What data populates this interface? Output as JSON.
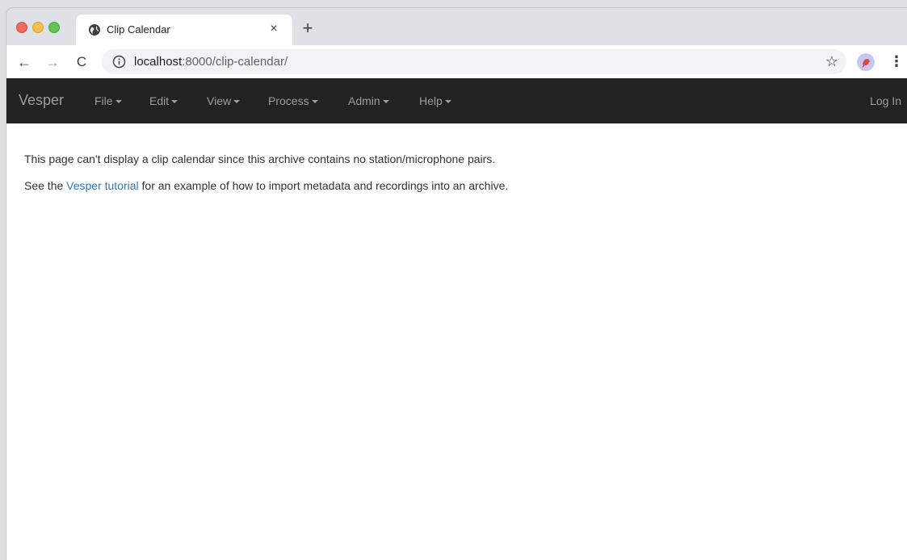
{
  "browser": {
    "tab_title": "Clip Calendar",
    "tab_close": "×",
    "new_tab": "+",
    "url_host": "localhost",
    "url_path": ":8000/clip-calendar/",
    "nav": {
      "back": "←",
      "forward": "→",
      "reload": "C"
    },
    "star": "☆",
    "menu": "⋮"
  },
  "navbar": {
    "brand": "Vesper",
    "menus": [
      "File",
      "Edit",
      "View",
      "Process",
      "Admin",
      "Help"
    ],
    "login": "Log In"
  },
  "content": {
    "line1": "This page can't display a clip calendar since this archive contains no station/microphone pairs.",
    "line2_prefix": "See the ",
    "line2_link": "Vesper tutorial",
    "line2_suffix": " for an example of how to import metadata and recordings into an archive."
  },
  "colors": {
    "navbar_bg": "#222222",
    "navbar_text": "#9d9d9d",
    "link": "#337ab7"
  }
}
